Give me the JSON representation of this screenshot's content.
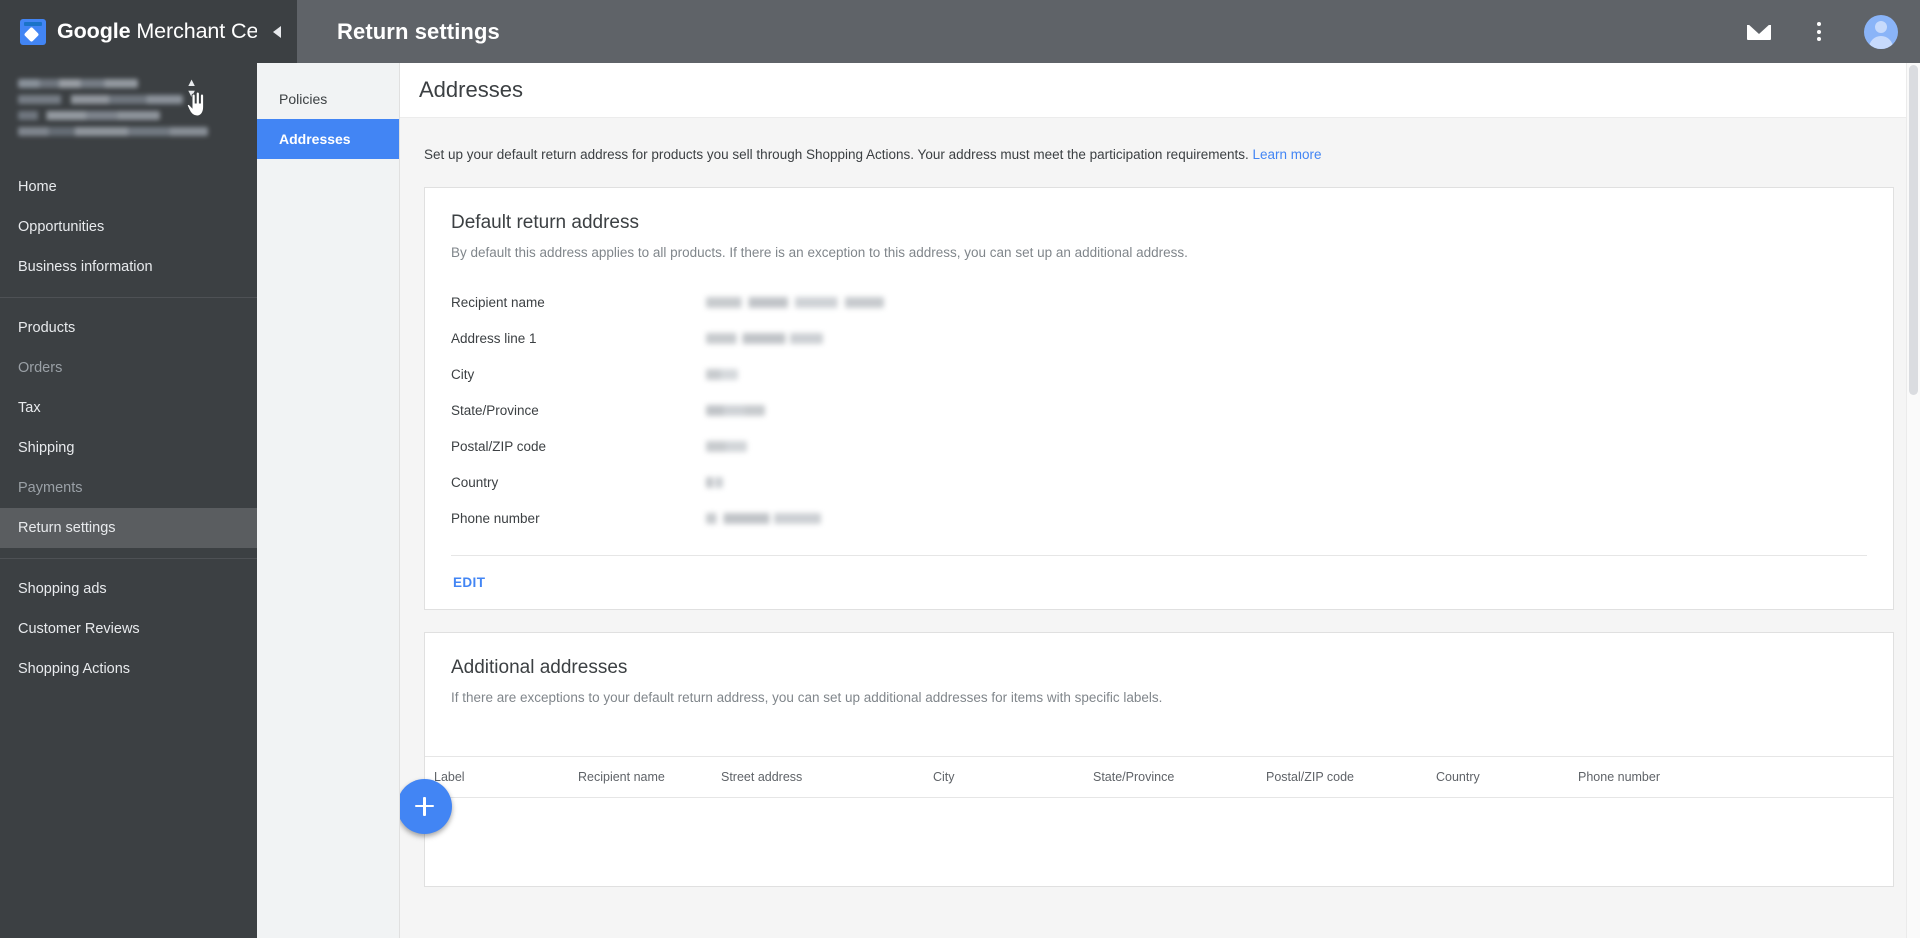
{
  "brand": {
    "logo_icon": "merchant-center-logo",
    "name_bold": "Google",
    "name_rest": " Merchant Center"
  },
  "topbar": {
    "collapse_icon": "chevron-left-icon",
    "page_title": "Return settings",
    "mail_icon": "mail-icon",
    "overflow_icon": "more-vert-icon",
    "avatar_icon": "account-avatar"
  },
  "sidebar": {
    "account": {
      "redacted_lines": 4,
      "selector_icon": "chevron-up-down-icon",
      "cursor_icon": "pointer-hand-cursor"
    },
    "groups": [
      {
        "items": [
          {
            "label": "Home",
            "state": "normal"
          },
          {
            "label": "Opportunities",
            "state": "normal"
          },
          {
            "label": "Business information",
            "state": "normal"
          }
        ]
      },
      {
        "items": [
          {
            "label": "Products",
            "state": "normal"
          },
          {
            "label": "Orders",
            "state": "dim"
          },
          {
            "label": "Tax",
            "state": "normal"
          },
          {
            "label": "Shipping",
            "state": "normal"
          },
          {
            "label": "Payments",
            "state": "dim"
          },
          {
            "label": "Return settings",
            "state": "active"
          }
        ]
      },
      {
        "items": [
          {
            "label": "Shopping ads",
            "state": "normal"
          },
          {
            "label": "Customer Reviews",
            "state": "normal"
          },
          {
            "label": "Shopping Actions",
            "state": "normal"
          }
        ]
      }
    ]
  },
  "subnav": {
    "items": [
      {
        "label": "Policies",
        "selected": false
      },
      {
        "label": "Addresses",
        "selected": true
      }
    ]
  },
  "main": {
    "heading": "Addresses",
    "intro": "Set up your default return address for products you sell through Shopping Actions. Your address must meet the participation requirements.",
    "intro_link": "Learn more",
    "default_card": {
      "title": "Default return address",
      "subtitle": "By default this address applies to all products. If there is an exception to this address, you can set up an additional address.",
      "fields": [
        {
          "label": "Recipient name",
          "value": "",
          "redacted": true
        },
        {
          "label": "Address line 1",
          "value": "",
          "redacted": true
        },
        {
          "label": "City",
          "value": "",
          "redacted": true
        },
        {
          "label": "State/Province",
          "value": "",
          "redacted": true
        },
        {
          "label": "Postal/ZIP code",
          "value": "",
          "redacted": true
        },
        {
          "label": "Country",
          "value": "",
          "redacted": true
        },
        {
          "label": "Phone number",
          "value": "",
          "redacted": true
        }
      ],
      "edit_label": "EDIT"
    },
    "additional_card": {
      "title": "Additional addresses",
      "subtitle": "If there are exceptions to your default return address, you can set up additional addresses for items with specific labels.",
      "add_icon": "plus-icon",
      "columns": [
        "Label",
        "Recipient name",
        "Street address",
        "City",
        "State/Province",
        "Postal/ZIP code",
        "Country",
        "Phone number"
      ],
      "rows": []
    }
  },
  "colors": {
    "accent_blue": "#4285f4",
    "topbar_left": "#3c4043",
    "topbar_right": "#5f6368",
    "subnav_bg": "#f1f3f4",
    "page_bg": "#f5f5f5"
  }
}
